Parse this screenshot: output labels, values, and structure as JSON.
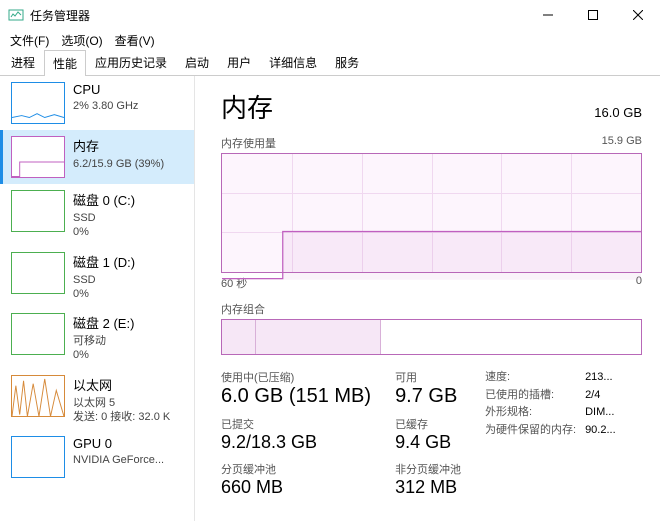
{
  "window": {
    "title": "任务管理器"
  },
  "menu": {
    "file": "文件(F)",
    "options": "选项(O)",
    "view": "查看(V)"
  },
  "tabs": [
    "进程",
    "性能",
    "应用历史记录",
    "启动",
    "用户",
    "详细信息",
    "服务"
  ],
  "active_tab": 1,
  "sidebar": {
    "items": [
      {
        "name": "CPU",
        "sub": "2% 3.80 GHz"
      },
      {
        "name": "内存",
        "sub": "6.2/15.9 GB (39%)"
      },
      {
        "name": "磁盘 0 (C:)",
        "sub": "SSD\n0%"
      },
      {
        "name": "磁盘 1 (D:)",
        "sub": "SSD\n0%"
      },
      {
        "name": "磁盘 2 (E:)",
        "sub": "可移动\n0%"
      },
      {
        "name": "以太网",
        "sub": "以太网 5\n发送: 0 接收: 32.0 K"
      },
      {
        "name": "GPU 0",
        "sub": "NVIDIA GeForce..."
      }
    ],
    "selected": 1
  },
  "main": {
    "title": "内存",
    "capacity": "16.0 GB",
    "graph_label": "内存使用量",
    "graph_max": "15.9 GB",
    "xaxis_left": "60 秒",
    "xaxis_right": "0",
    "comp_label": "内存组合",
    "stats": {
      "in_use_label": "使用中(已压缩)",
      "in_use_value": "6.0 GB (151 MB)",
      "avail_label": "可用",
      "avail_value": "9.7 GB",
      "committed_label": "已提交",
      "committed_value": "9.2/18.3 GB",
      "cached_label": "已缓存",
      "cached_value": "9.4 GB",
      "paged_label": "分页缓冲池",
      "paged_value": "660 MB",
      "nonpaged_label": "非分页缓冲池",
      "nonpaged_value": "312 MB"
    },
    "specs": {
      "speed_k": "速度:",
      "speed_v": "213...",
      "slots_k": "已使用的插槽:",
      "slots_v": "2/4",
      "form_k": "外形规格:",
      "form_v": "DIM...",
      "reserved_k": "为硬件保留的内存:",
      "reserved_v": "90.2..."
    }
  },
  "chart_data": {
    "type": "area",
    "title": "内存使用量",
    "ylabel": "GB",
    "ylim": [
      0,
      15.9
    ],
    "xlabel": "秒",
    "xlim": [
      60,
      0
    ],
    "series": [
      {
        "name": "内存使用量",
        "values": [
          0.2,
          0.2,
          0.2,
          0.2,
          0.2,
          0.2,
          6.2,
          6.2,
          6.2,
          6.2,
          6.2,
          6.2,
          6.2,
          6.2,
          6.2,
          6.2,
          6.2,
          6.2,
          6.2,
          6.2,
          6.2,
          6.2,
          6.2,
          6.2,
          6.2,
          6.2,
          6.2,
          6.2,
          6.2,
          6.2
        ]
      }
    ]
  }
}
